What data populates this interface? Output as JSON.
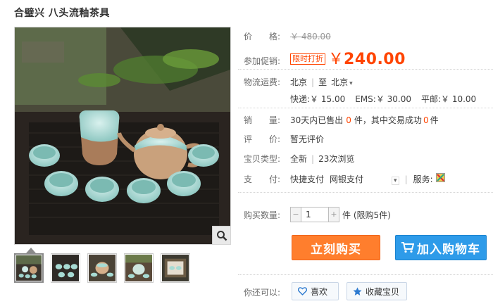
{
  "product": {
    "title": "合璧兴 八头流釉茶具"
  },
  "price": {
    "label": "价　　格:",
    "original": "￥ 480.00"
  },
  "promo": {
    "label": "参加促销:",
    "badge": "限时打折",
    "yen": "￥",
    "price": "240.00"
  },
  "shipping": {
    "label": "物流运费:",
    "from": "北京",
    "to_prefix": "至",
    "to": "北京",
    "express": "快递:￥ 15.00",
    "ems": "EMS:￥ 30.00",
    "surface": "平邮:￥ 10.00"
  },
  "sales": {
    "label": "销　　量:",
    "prefix": "30天内已售出",
    "sold": "0",
    "middle": "件，其中交易成功",
    "success": "0",
    "suffix": "件"
  },
  "review": {
    "label": "评　　价:",
    "value": "暂无评价"
  },
  "item_type": {
    "label": "宝贝类型:",
    "condition": "全新",
    "views": "23次浏览"
  },
  "payment": {
    "label": "支　　付:",
    "method1": "快捷支付",
    "method2": "网银支付",
    "service_label": "服务:"
  },
  "purchase": {
    "label": "购买数量:",
    "quantity": "1",
    "unit_note": "件 (限购5件)",
    "buy_now": "立刻购买",
    "add_to_cart": "加入购物车"
  },
  "actions": {
    "label": "你还可以:",
    "like": "喜欢",
    "favorite": "收藏宝贝"
  },
  "colors": {
    "accent": "#ff4400",
    "buy_button": "#ff7e2d",
    "cart_button": "#2e9be9"
  },
  "icons": {
    "zoom": "magnifier-icon",
    "cart": "shopping-cart-icon",
    "heart": "heart-icon",
    "star": "star-icon",
    "service": "service-badge-icon"
  }
}
